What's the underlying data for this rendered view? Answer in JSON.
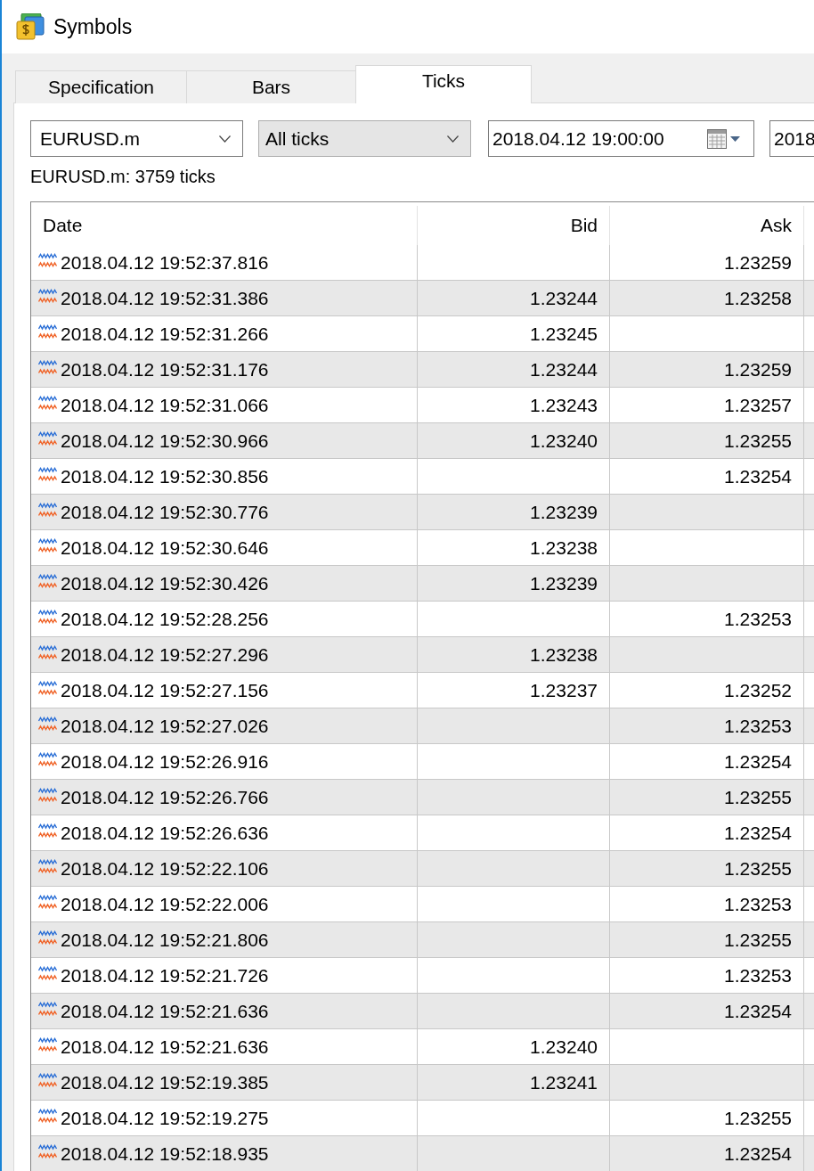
{
  "window": {
    "title": "Symbols"
  },
  "tabs": [
    {
      "label": "Specification",
      "selected": false
    },
    {
      "label": "Bars",
      "selected": false
    },
    {
      "label": "Ticks",
      "selected": true
    }
  ],
  "toolbar": [
    {
      "kind": "combo",
      "value": "EURUSD.m"
    },
    {
      "kind": "dropdown",
      "value": "All ticks"
    },
    {
      "kind": "date",
      "value": "2018.04.12 19:00:00"
    },
    {
      "kind": "date",
      "value": "2018"
    }
  ],
  "summary": "EURUSD.m: 3759 ticks",
  "table": {
    "columns": [
      "Date",
      "Bid",
      "Ask"
    ],
    "rows": [
      {
        "date": "2018.04.12 19:52:37.816",
        "ask": "1.23259"
      },
      {
        "date": "2018.04.12 19:52:31.386",
        "bid": "1.23244",
        "ask": "1.23258"
      },
      {
        "date": "2018.04.12 19:52:31.266",
        "bid": "1.23245"
      },
      {
        "date": "2018.04.12 19:52:31.176",
        "bid": "1.23244",
        "ask": "1.23259"
      },
      {
        "date": "2018.04.12 19:52:31.066",
        "bid": "1.23243",
        "ask": "1.23257"
      },
      {
        "date": "2018.04.12 19:52:30.966",
        "bid": "1.23240",
        "ask": "1.23255"
      },
      {
        "date": "2018.04.12 19:52:30.856",
        "ask": "1.23254"
      },
      {
        "date": "2018.04.12 19:52:30.776",
        "bid": "1.23239"
      },
      {
        "date": "2018.04.12 19:52:30.646",
        "bid": "1.23238"
      },
      {
        "date": "2018.04.12 19:52:30.426",
        "bid": "1.23239"
      },
      {
        "date": "2018.04.12 19:52:28.256",
        "ask": "1.23253"
      },
      {
        "date": "2018.04.12 19:52:27.296",
        "bid": "1.23238"
      },
      {
        "date": "2018.04.12 19:52:27.156",
        "bid": "1.23237",
        "ask": "1.23252"
      },
      {
        "date": "2018.04.12 19:52:27.026",
        "ask": "1.23253"
      },
      {
        "date": "2018.04.12 19:52:26.916",
        "ask": "1.23254"
      },
      {
        "date": "2018.04.12 19:52:26.766",
        "ask": "1.23255"
      },
      {
        "date": "2018.04.12 19:52:26.636",
        "ask": "1.23254"
      },
      {
        "date": "2018.04.12 19:52:22.106",
        "ask": "1.23255"
      },
      {
        "date": "2018.04.12 19:52:22.006",
        "ask": "1.23253"
      },
      {
        "date": "2018.04.12 19:52:21.806",
        "ask": "1.23255"
      },
      {
        "date": "2018.04.12 19:52:21.726",
        "ask": "1.23253"
      },
      {
        "date": "2018.04.12 19:52:21.636",
        "ask": "1.23254"
      },
      {
        "date": "2018.04.12 19:52:21.636",
        "bid": "1.23240"
      },
      {
        "date": "2018.04.12 19:52:19.385",
        "bid": "1.23241"
      },
      {
        "date": "2018.04.12 19:52:19.275",
        "ask": "1.23255"
      },
      {
        "date": "2018.04.12 19:52:18.935",
        "ask": "1.23254"
      }
    ]
  }
}
